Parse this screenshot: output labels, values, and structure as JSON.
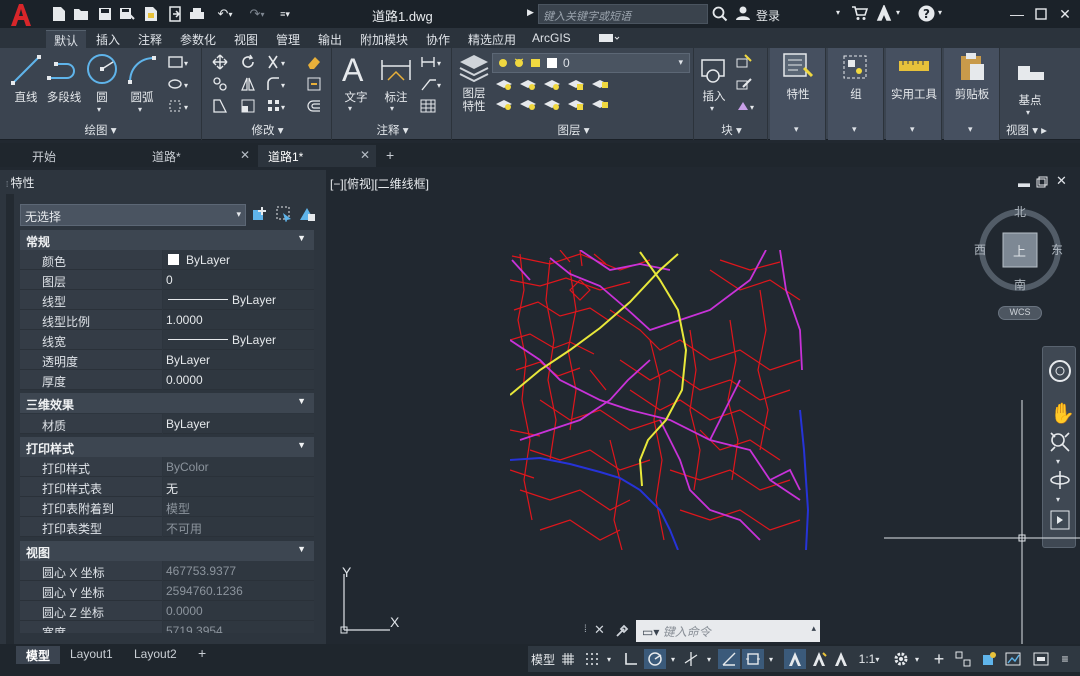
{
  "app": {
    "document_title": "道路1.dwg",
    "search_placeholder": "键入关键字或短语",
    "login_label": "登录"
  },
  "ribbon_tabs": [
    "默认",
    "插入",
    "注释",
    "参数化",
    "视图",
    "管理",
    "输出",
    "附加模块",
    "协作",
    "精选应用",
    "ArcGIS"
  ],
  "ribbon": {
    "draw": {
      "label": "绘图",
      "buttons": [
        "直线",
        "多段线",
        "圆",
        "圆弧"
      ]
    },
    "modify": {
      "label": "修改"
    },
    "annotation": {
      "label": "注释",
      "buttons": [
        "文字",
        "标注"
      ]
    },
    "layers": {
      "label": "图层",
      "layer_props": "图层\n特性",
      "layer_props_line1": "图层",
      "layer_props_line2": "特性",
      "current_layer": "0"
    },
    "block": {
      "label": "块",
      "insert": "插入"
    },
    "properties": {
      "label": "特性"
    },
    "group": {
      "label": "组"
    },
    "utilities": {
      "label": "实用工具"
    },
    "clipboard": {
      "label": "剪贴板"
    },
    "view": {
      "label": "视图",
      "basepoint": "基点"
    }
  },
  "doc_tabs": [
    {
      "label": "开始"
    },
    {
      "label": "道路*"
    },
    {
      "label": "道路1*"
    }
  ],
  "properties_palette": {
    "title": "特性",
    "selection": "无选择",
    "sections": {
      "general": "常规",
      "3d": "三维效果",
      "plot": "打印样式",
      "view": "视图"
    },
    "general_rows": [
      {
        "key": "颜色",
        "value": "ByLayer"
      },
      {
        "key": "图层",
        "value": "0"
      },
      {
        "key": "线型",
        "value": "ByLayer"
      },
      {
        "key": "线型比例",
        "value": "1.0000"
      },
      {
        "key": "线宽",
        "value": "ByLayer"
      },
      {
        "key": "透明度",
        "value": "ByLayer"
      },
      {
        "key": "厚度",
        "value": "0.0000"
      }
    ],
    "3d_rows": [
      {
        "key": "材质",
        "value": "ByLayer"
      }
    ],
    "plot_rows": [
      {
        "key": "打印样式",
        "value": "ByColor"
      },
      {
        "key": "打印样式表",
        "value": "无"
      },
      {
        "key": "打印表附着到",
        "value": "模型"
      },
      {
        "key": "打印表类型",
        "value": "不可用"
      }
    ],
    "view_rows": [
      {
        "key": "圆心 X 坐标",
        "value": "467753.9377"
      },
      {
        "key": "圆心 Y 坐标",
        "value": "2594760.1236"
      },
      {
        "key": "圆心 Z 坐标",
        "value": "0.0000"
      },
      {
        "key": "宽度",
        "value": "5719.3954"
      }
    ]
  },
  "viewport": {
    "label": "[−][俯视][二维线框]",
    "viewcube": {
      "north": "北",
      "south": "南",
      "east": "东",
      "west": "西",
      "wcs": "WCS"
    },
    "ucs_x": "X",
    "ucs_y": "Y"
  },
  "command_line": {
    "placeholder": "键入命令"
  },
  "layout_tabs": [
    "模型",
    "Layout1",
    "Layout2"
  ],
  "statusbar": {
    "model": "模型",
    "scale": "1:1"
  },
  "colors": {
    "background": "#212830",
    "red_roads": "#e0161c",
    "magenta_roads": "#c832d8",
    "yellow_roads": "#e8e83a",
    "blue_roads": "#2633d8"
  }
}
